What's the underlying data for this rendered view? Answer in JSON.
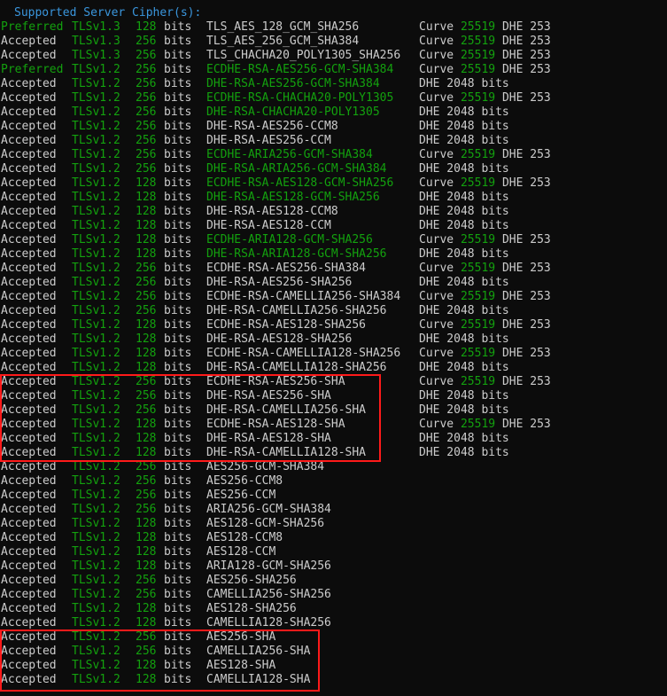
{
  "heading": "Supported Server Cipher(s):",
  "colors": {
    "background": "#0c0c0c",
    "text": "#cccccc",
    "green": "#13a10e",
    "heading": "#3a96dd",
    "highlight": "#ff1a1a"
  },
  "rows": [
    {
      "status": "Preferred",
      "proto": "TLSv1.3",
      "bits": "128",
      "unit": "bits",
      "cipher": "TLS_AES_128_GCM_SHA256",
      "cipher_green": false,
      "kx_label": "Curve",
      "kx_value": "25519",
      "kx_extra": "DHE 253",
      "kx_type": "curve"
    },
    {
      "status": "Accepted",
      "proto": "TLSv1.3",
      "bits": "256",
      "unit": "bits",
      "cipher": "TLS_AES_256_GCM_SHA384",
      "cipher_green": false,
      "kx_label": "Curve",
      "kx_value": "25519",
      "kx_extra": "DHE 253",
      "kx_type": "curve"
    },
    {
      "status": "Accepted",
      "proto": "TLSv1.3",
      "bits": "256",
      "unit": "bits",
      "cipher": "TLS_CHACHA20_POLY1305_SHA256",
      "cipher_green": false,
      "kx_label": "Curve",
      "kx_value": "25519",
      "kx_extra": "DHE 253",
      "kx_type": "curve"
    },
    {
      "status": "Preferred",
      "proto": "TLSv1.2",
      "bits": "256",
      "unit": "bits",
      "cipher": "ECDHE-RSA-AES256-GCM-SHA384",
      "cipher_green": true,
      "kx_label": "Curve",
      "kx_value": "25519",
      "kx_extra": "DHE 253",
      "kx_type": "curve"
    },
    {
      "status": "Accepted",
      "proto": "TLSv1.2",
      "bits": "256",
      "unit": "bits",
      "cipher": "DHE-RSA-AES256-GCM-SHA384",
      "cipher_green": true,
      "kx_label": "DHE 2048 bits",
      "kx_type": "dhe"
    },
    {
      "status": "Accepted",
      "proto": "TLSv1.2",
      "bits": "256",
      "unit": "bits",
      "cipher": "ECDHE-RSA-CHACHA20-POLY1305",
      "cipher_green": true,
      "kx_label": "Curve",
      "kx_value": "25519",
      "kx_extra": "DHE 253",
      "kx_type": "curve"
    },
    {
      "status": "Accepted",
      "proto": "TLSv1.2",
      "bits": "256",
      "unit": "bits",
      "cipher": "DHE-RSA-CHACHA20-POLY1305",
      "cipher_green": true,
      "kx_label": "DHE 2048 bits",
      "kx_type": "dhe"
    },
    {
      "status": "Accepted",
      "proto": "TLSv1.2",
      "bits": "256",
      "unit": "bits",
      "cipher": "DHE-RSA-AES256-CCM8",
      "cipher_green": false,
      "kx_label": "DHE 2048 bits",
      "kx_type": "dhe"
    },
    {
      "status": "Accepted",
      "proto": "TLSv1.2",
      "bits": "256",
      "unit": "bits",
      "cipher": "DHE-RSA-AES256-CCM",
      "cipher_green": false,
      "kx_label": "DHE 2048 bits",
      "kx_type": "dhe"
    },
    {
      "status": "Accepted",
      "proto": "TLSv1.2",
      "bits": "256",
      "unit": "bits",
      "cipher": "ECDHE-ARIA256-GCM-SHA384",
      "cipher_green": true,
      "kx_label": "Curve",
      "kx_value": "25519",
      "kx_extra": "DHE 253",
      "kx_type": "curve"
    },
    {
      "status": "Accepted",
      "proto": "TLSv1.2",
      "bits": "256",
      "unit": "bits",
      "cipher": "DHE-RSA-ARIA256-GCM-SHA384",
      "cipher_green": true,
      "kx_label": "DHE 2048 bits",
      "kx_type": "dhe"
    },
    {
      "status": "Accepted",
      "proto": "TLSv1.2",
      "bits": "128",
      "unit": "bits",
      "cipher": "ECDHE-RSA-AES128-GCM-SHA256",
      "cipher_green": true,
      "kx_label": "Curve",
      "kx_value": "25519",
      "kx_extra": "DHE 253",
      "kx_type": "curve"
    },
    {
      "status": "Accepted",
      "proto": "TLSv1.2",
      "bits": "128",
      "unit": "bits",
      "cipher": "DHE-RSA-AES128-GCM-SHA256",
      "cipher_green": true,
      "kx_label": "DHE 2048 bits",
      "kx_type": "dhe"
    },
    {
      "status": "Accepted",
      "proto": "TLSv1.2",
      "bits": "128",
      "unit": "bits",
      "cipher": "DHE-RSA-AES128-CCM8",
      "cipher_green": false,
      "kx_label": "DHE 2048 bits",
      "kx_type": "dhe"
    },
    {
      "status": "Accepted",
      "proto": "TLSv1.2",
      "bits": "128",
      "unit": "bits",
      "cipher": "DHE-RSA-AES128-CCM",
      "cipher_green": false,
      "kx_label": "DHE 2048 bits",
      "kx_type": "dhe"
    },
    {
      "status": "Accepted",
      "proto": "TLSv1.2",
      "bits": "128",
      "unit": "bits",
      "cipher": "ECDHE-ARIA128-GCM-SHA256",
      "cipher_green": true,
      "kx_label": "Curve",
      "kx_value": "25519",
      "kx_extra": "DHE 253",
      "kx_type": "curve"
    },
    {
      "status": "Accepted",
      "proto": "TLSv1.2",
      "bits": "128",
      "unit": "bits",
      "cipher": "DHE-RSA-ARIA128-GCM-SHA256",
      "cipher_green": true,
      "kx_label": "DHE 2048 bits",
      "kx_type": "dhe"
    },
    {
      "status": "Accepted",
      "proto": "TLSv1.2",
      "bits": "256",
      "unit": "bits",
      "cipher": "ECDHE-RSA-AES256-SHA384",
      "cipher_green": false,
      "kx_label": "Curve",
      "kx_value": "25519",
      "kx_extra": "DHE 253",
      "kx_type": "curve"
    },
    {
      "status": "Accepted",
      "proto": "TLSv1.2",
      "bits": "256",
      "unit": "bits",
      "cipher": "DHE-RSA-AES256-SHA256",
      "cipher_green": false,
      "kx_label": "DHE 2048 bits",
      "kx_type": "dhe"
    },
    {
      "status": "Accepted",
      "proto": "TLSv1.2",
      "bits": "256",
      "unit": "bits",
      "cipher": "ECDHE-RSA-CAMELLIA256-SHA384",
      "cipher_green": false,
      "kx_label": "Curve",
      "kx_value": "25519",
      "kx_extra": "DHE 253",
      "kx_type": "curve"
    },
    {
      "status": "Accepted",
      "proto": "TLSv1.2",
      "bits": "256",
      "unit": "bits",
      "cipher": "DHE-RSA-CAMELLIA256-SHA256",
      "cipher_green": false,
      "kx_label": "DHE 2048 bits",
      "kx_type": "dhe"
    },
    {
      "status": "Accepted",
      "proto": "TLSv1.2",
      "bits": "128",
      "unit": "bits",
      "cipher": "ECDHE-RSA-AES128-SHA256",
      "cipher_green": false,
      "kx_label": "Curve",
      "kx_value": "25519",
      "kx_extra": "DHE 253",
      "kx_type": "curve"
    },
    {
      "status": "Accepted",
      "proto": "TLSv1.2",
      "bits": "128",
      "unit": "bits",
      "cipher": "DHE-RSA-AES128-SHA256",
      "cipher_green": false,
      "kx_label": "DHE 2048 bits",
      "kx_type": "dhe"
    },
    {
      "status": "Accepted",
      "proto": "TLSv1.2",
      "bits": "128",
      "unit": "bits",
      "cipher": "ECDHE-RSA-CAMELLIA128-SHA256",
      "cipher_green": false,
      "kx_label": "Curve",
      "kx_value": "25519",
      "kx_extra": "DHE 253",
      "kx_type": "curve"
    },
    {
      "status": "Accepted",
      "proto": "TLSv1.2",
      "bits": "128",
      "unit": "bits",
      "cipher": "DHE-RSA-CAMELLIA128-SHA256",
      "cipher_green": false,
      "kx_label": "DHE 2048 bits",
      "kx_type": "dhe"
    },
    {
      "status": "Accepted",
      "proto": "TLSv1.2",
      "bits": "256",
      "unit": "bits",
      "cipher": "ECDHE-RSA-AES256-SHA",
      "cipher_green": false,
      "kx_label": "Curve",
      "kx_value": "25519",
      "kx_extra": "DHE 253",
      "kx_type": "curve"
    },
    {
      "status": "Accepted",
      "proto": "TLSv1.2",
      "bits": "256",
      "unit": "bits",
      "cipher": "DHE-RSA-AES256-SHA",
      "cipher_green": false,
      "kx_label": "DHE 2048 bits",
      "kx_type": "dhe"
    },
    {
      "status": "Accepted",
      "proto": "TLSv1.2",
      "bits": "256",
      "unit": "bits",
      "cipher": "DHE-RSA-CAMELLIA256-SHA",
      "cipher_green": false,
      "kx_label": "DHE 2048 bits",
      "kx_type": "dhe"
    },
    {
      "status": "Accepted",
      "proto": "TLSv1.2",
      "bits": "128",
      "unit": "bits",
      "cipher": "ECDHE-RSA-AES128-SHA",
      "cipher_green": false,
      "kx_label": "Curve",
      "kx_value": "25519",
      "kx_extra": "DHE 253",
      "kx_type": "curve"
    },
    {
      "status": "Accepted",
      "proto": "TLSv1.2",
      "bits": "128",
      "unit": "bits",
      "cipher": "DHE-RSA-AES128-SHA",
      "cipher_green": false,
      "kx_label": "DHE 2048 bits",
      "kx_type": "dhe"
    },
    {
      "status": "Accepted",
      "proto": "TLSv1.2",
      "bits": "128",
      "unit": "bits",
      "cipher": "DHE-RSA-CAMELLIA128-SHA",
      "cipher_green": false,
      "kx_label": "DHE 2048 bits",
      "kx_type": "dhe"
    },
    {
      "status": "Accepted",
      "proto": "TLSv1.2",
      "bits": "256",
      "unit": "bits",
      "cipher": "AES256-GCM-SHA384",
      "cipher_green": false,
      "kx_type": "none"
    },
    {
      "status": "Accepted",
      "proto": "TLSv1.2",
      "bits": "256",
      "unit": "bits",
      "cipher": "AES256-CCM8",
      "cipher_green": false,
      "kx_type": "none"
    },
    {
      "status": "Accepted",
      "proto": "TLSv1.2",
      "bits": "256",
      "unit": "bits",
      "cipher": "AES256-CCM",
      "cipher_green": false,
      "kx_type": "none"
    },
    {
      "status": "Accepted",
      "proto": "TLSv1.2",
      "bits": "256",
      "unit": "bits",
      "cipher": "ARIA256-GCM-SHA384",
      "cipher_green": false,
      "kx_type": "none"
    },
    {
      "status": "Accepted",
      "proto": "TLSv1.2",
      "bits": "128",
      "unit": "bits",
      "cipher": "AES128-GCM-SHA256",
      "cipher_green": false,
      "kx_type": "none"
    },
    {
      "status": "Accepted",
      "proto": "TLSv1.2",
      "bits": "128",
      "unit": "bits",
      "cipher": "AES128-CCM8",
      "cipher_green": false,
      "kx_type": "none"
    },
    {
      "status": "Accepted",
      "proto": "TLSv1.2",
      "bits": "128",
      "unit": "bits",
      "cipher": "AES128-CCM",
      "cipher_green": false,
      "kx_type": "none"
    },
    {
      "status": "Accepted",
      "proto": "TLSv1.2",
      "bits": "128",
      "unit": "bits",
      "cipher": "ARIA128-GCM-SHA256",
      "cipher_green": false,
      "kx_type": "none"
    },
    {
      "status": "Accepted",
      "proto": "TLSv1.2",
      "bits": "256",
      "unit": "bits",
      "cipher": "AES256-SHA256",
      "cipher_green": false,
      "kx_type": "none"
    },
    {
      "status": "Accepted",
      "proto": "TLSv1.2",
      "bits": "256",
      "unit": "bits",
      "cipher": "CAMELLIA256-SHA256",
      "cipher_green": false,
      "kx_type": "none"
    },
    {
      "status": "Accepted",
      "proto": "TLSv1.2",
      "bits": "128",
      "unit": "bits",
      "cipher": "AES128-SHA256",
      "cipher_green": false,
      "kx_type": "none"
    },
    {
      "status": "Accepted",
      "proto": "TLSv1.2",
      "bits": "128",
      "unit": "bits",
      "cipher": "CAMELLIA128-SHA256",
      "cipher_green": false,
      "kx_type": "none"
    },
    {
      "status": "Accepted",
      "proto": "TLSv1.2",
      "bits": "256",
      "unit": "bits",
      "cipher": "AES256-SHA",
      "cipher_green": false,
      "kx_type": "none"
    },
    {
      "status": "Accepted",
      "proto": "TLSv1.2",
      "bits": "256",
      "unit": "bits",
      "cipher": "CAMELLIA256-SHA",
      "cipher_green": false,
      "kx_type": "none"
    },
    {
      "status": "Accepted",
      "proto": "TLSv1.2",
      "bits": "128",
      "unit": "bits",
      "cipher": "AES128-SHA",
      "cipher_green": false,
      "kx_type": "none"
    },
    {
      "status": "Accepted",
      "proto": "TLSv1.2",
      "bits": "128",
      "unit": "bits",
      "cipher": "CAMELLIA128-SHA",
      "cipher_green": false,
      "kx_type": "none"
    }
  ]
}
